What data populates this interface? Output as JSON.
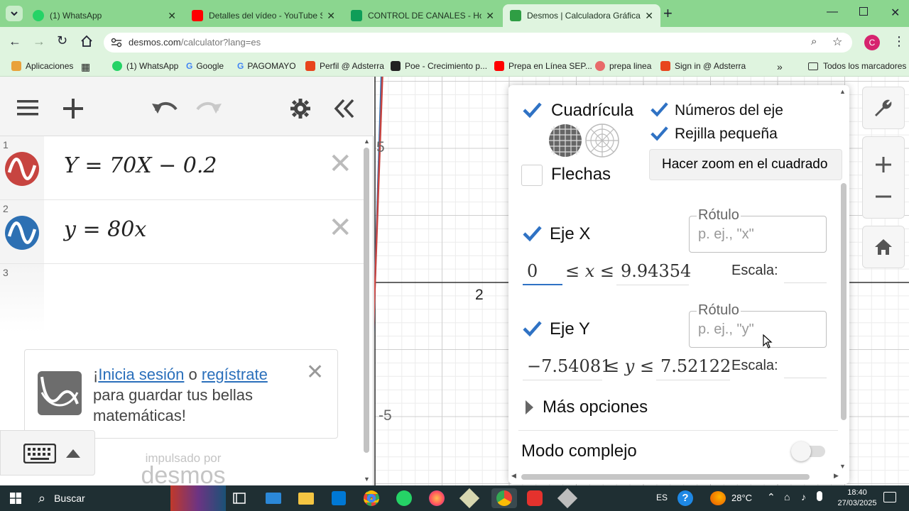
{
  "browser": {
    "tabs": [
      {
        "title": "(1) WhatsApp",
        "color": "#25d366"
      },
      {
        "title": "Detalles del vídeo - YouTube St",
        "color": "#ff0000"
      },
      {
        "title": "CONTROL DE CANALES - Hojas",
        "color": "#0f9d58"
      },
      {
        "title": "Desmos | Calculadora Gráfica",
        "color": "#2f9e44"
      }
    ],
    "new_tab": "+",
    "url_domain": "desmos.com",
    "url_path": "/calculator?lang=es",
    "profile_initial": "C",
    "bookmarks": [
      {
        "label": "Aplicaciones",
        "icon": "apps-icon",
        "color": "#e9a23b"
      },
      {
        "label": "(1) WhatsApp",
        "icon": "whatsapp-icon",
        "color": "#25d366"
      },
      {
        "label": "Google",
        "icon": "google-icon",
        "color": "#4285f4"
      },
      {
        "label": "PAGOMAYO",
        "icon": "google-icon",
        "color": "#4285f4"
      },
      {
        "label": "Perfil @ Adsterra",
        "icon": "adsterra-icon",
        "color": "#e8451c"
      },
      {
        "label": "Poe - Crecimiento p...",
        "icon": "poe-icon",
        "color": "#222222"
      },
      {
        "label": "Prepa en Línea SEP...",
        "icon": "youtube-icon",
        "color": "#ff0000"
      },
      {
        "label": "prepa linea",
        "icon": "flower-icon",
        "color": "#e86a6a"
      },
      {
        "label": "Sign in @ Adsterra",
        "icon": "adsterra-icon",
        "color": "#e8451c"
      }
    ],
    "more_bookmarks": "»",
    "all_bookmarks": "Todos los marcadores"
  },
  "expressions": [
    {
      "num": "1",
      "latex": "Y = 70X − 0.2",
      "color": "#c74440"
    },
    {
      "num": "2",
      "latex": "y = 80x",
      "color": "#2d70b3"
    },
    {
      "num": "3",
      "latex": ""
    }
  ],
  "signin": {
    "prefix": "¡",
    "link1": "Inicia sesión",
    "middle": " o ",
    "link2": "regístrate",
    "rest": "para guardar tus bellas matemáticas!"
  },
  "powered_by": {
    "line1": "impulsado por",
    "line2": "desmos"
  },
  "graph": {
    "x_ticks": [
      "2"
    ],
    "y_ticks": [
      "5",
      "-5"
    ]
  },
  "settings": {
    "grid_label": "Cuadrícula",
    "grid_checked": true,
    "axis_numbers_label": "Números del eje",
    "axis_numbers_checked": true,
    "minor_grid_label": "Rejilla pequeña",
    "minor_grid_checked": true,
    "arrows_label": "Flechas",
    "arrows_checked": false,
    "zoom_square_label": "Hacer zoom en el cuadrado",
    "x_axis": {
      "label": "Eje X",
      "checked": true,
      "legend": "Rótulo",
      "placeholder": "p. ej., \"x\"",
      "min": "0",
      "var": "x",
      "max": "9.94354",
      "scale_label": "Escala:"
    },
    "y_axis": {
      "label": "Eje Y",
      "checked": true,
      "legend": "Rótulo",
      "placeholder": "p. ej., \"y\"",
      "min": "−7.54081",
      "var": "y",
      "max": "7.52122",
      "scale_label": "Escala:"
    },
    "more_options": "Más opciones",
    "complex_mode": "Modo complejo",
    "complex_on": false
  },
  "taskbar": {
    "search": "Buscar",
    "lang": "ES",
    "temp": "28°C",
    "time": "18:40",
    "date": "27/03/2025"
  }
}
